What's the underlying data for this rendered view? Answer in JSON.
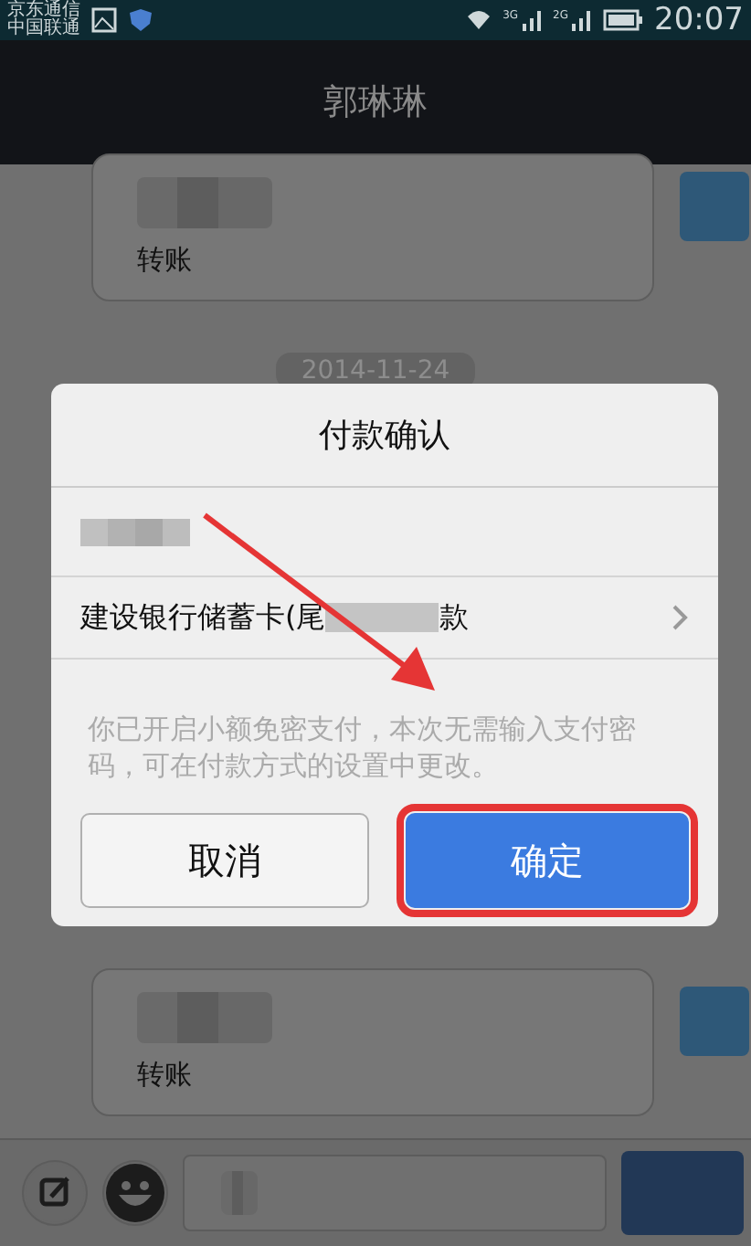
{
  "status_bar": {
    "carriers": [
      "京东通信",
      "中国联通"
    ],
    "network_labels": [
      "3G",
      "2G"
    ],
    "time": "20:07"
  },
  "header": {
    "title": "郭琳琳"
  },
  "chat": {
    "top": [
      {
        "kind": "transfer",
        "label": "转账"
      },
      {
        "kind": "date",
        "text": "2014-11-24"
      }
    ],
    "bottom": [
      {
        "kind": "transfer",
        "label": "转账"
      }
    ]
  },
  "dialog": {
    "title": "付款确认",
    "payment_method": {
      "before": "建设银行储蓄卡(尾",
      "after": "款"
    },
    "note": "你已开启小额免密支付，本次无需输入支付密码，可在付款方式的设置中更改。",
    "buttons": [
      {
        "label": "取消",
        "kind": "cancel",
        "highlighted": false
      },
      {
        "label": "确定",
        "kind": "confirm",
        "highlighted": true
      }
    ]
  }
}
